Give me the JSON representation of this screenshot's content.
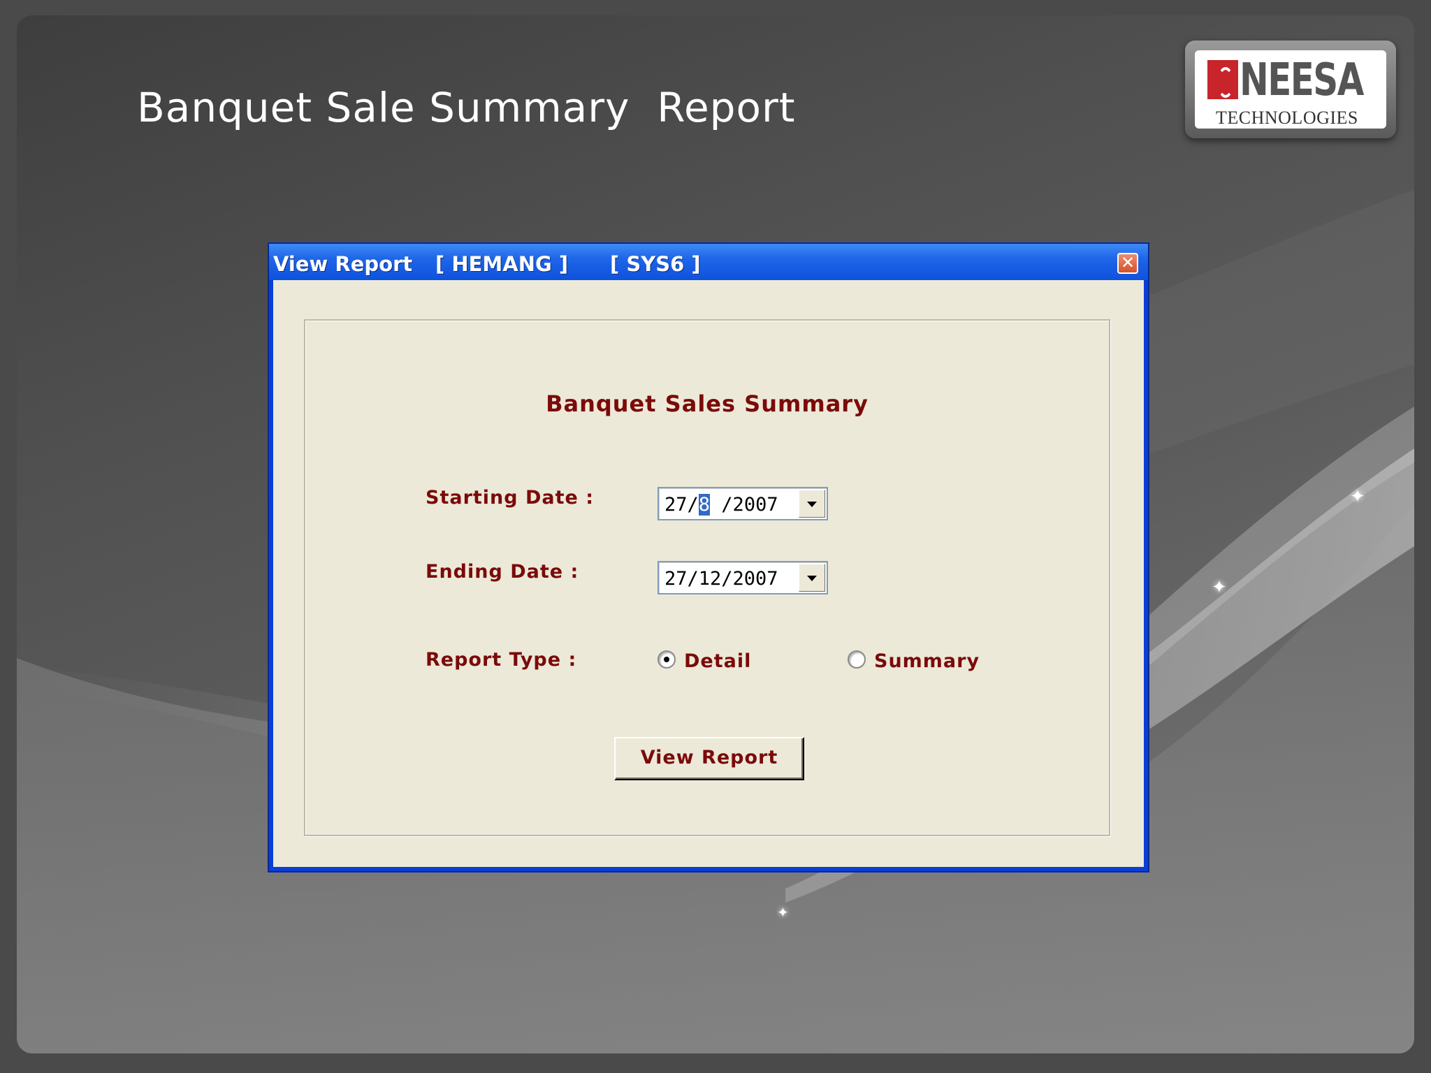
{
  "slide": {
    "title": "Banquet Sale Summary  Report"
  },
  "logo": {
    "name": "NEESA",
    "subtitle": "TECHNOLOGIES",
    "mark_icon": "neesa-logo-mark",
    "brand_color": "#c8242b"
  },
  "window": {
    "title": "View Report",
    "user": "[ HEMANG ]",
    "system": "[ SYS6 ]",
    "close_symbol": "✕",
    "titlebar_color": "#0e52dc"
  },
  "form": {
    "heading": "Banquet Sales Summary",
    "starting_date": {
      "label": "Starting Date :",
      "value_prefix": "27/",
      "value_selected": "8",
      "value_suffix": " /2007"
    },
    "ending_date": {
      "label": "Ending Date :",
      "value": "27/12/2007"
    },
    "report_type": {
      "label": "Report Type :",
      "options": [
        {
          "label": "Detail",
          "selected": true
        },
        {
          "label": "Summary",
          "selected": false
        }
      ]
    },
    "view_button": "View Report",
    "text_color": "#7b0a0a"
  }
}
